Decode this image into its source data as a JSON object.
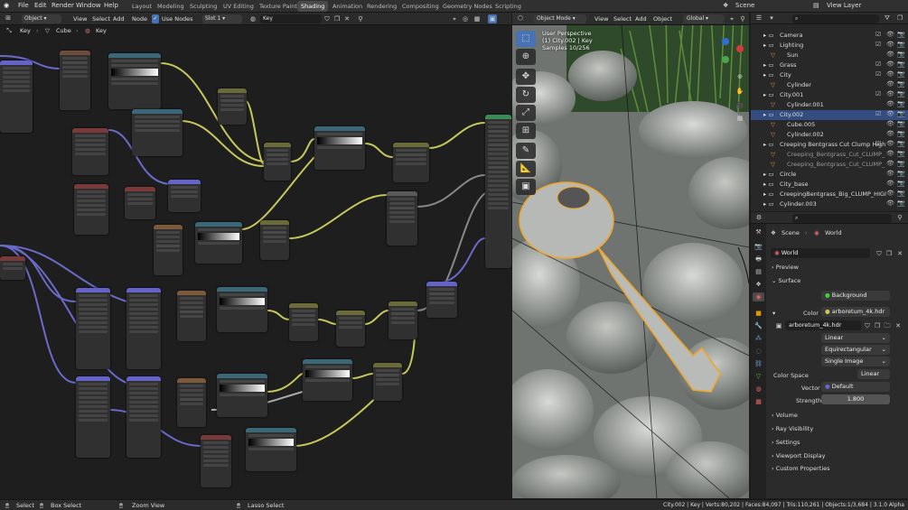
{
  "menu": {
    "file": "File",
    "edit": "Edit",
    "render": "Render",
    "window": "Window",
    "help": "Help"
  },
  "workspaces": [
    "Layout",
    "Modeling",
    "Sculpting",
    "UV Editing",
    "Texture Paint",
    "Shading",
    "Animation",
    "Rendering",
    "Compositing",
    "Geometry Nodes",
    "Scripting"
  ],
  "active_workspace": "Shading",
  "scene": {
    "label": "Scene"
  },
  "view_layer": {
    "label": "View Layer"
  },
  "node_editor": {
    "object_mode": "Object",
    "menus": [
      "View",
      "Select",
      "Add",
      "Node"
    ],
    "use_nodes_label": "Use Nodes",
    "slot": "Slot 1",
    "material": "Key",
    "breadcrumb": [
      "Key",
      "Cube",
      "Key"
    ]
  },
  "viewport": {
    "mode": "Object Mode",
    "menus": [
      "View",
      "Select",
      "Add",
      "Object"
    ],
    "orientation": "Global",
    "overlay_line1": "User Perspective",
    "overlay_line2": "(1) City.002 | Key",
    "overlay_line3": "Samples 10/256"
  },
  "outliner": {
    "rows": [
      {
        "name": "Camera",
        "indent": 1,
        "vis": "☑"
      },
      {
        "name": "Lighting",
        "indent": 1,
        "vis": "☑"
      },
      {
        "name": "Sun",
        "indent": 2,
        "vis": ""
      },
      {
        "name": "Grass",
        "indent": 1,
        "vis": "☑"
      },
      {
        "name": "City",
        "indent": 1,
        "vis": "☑"
      },
      {
        "name": "Cylinder",
        "indent": 2,
        "vis": ""
      },
      {
        "name": "City.001",
        "indent": 1,
        "vis": "☑"
      },
      {
        "name": "Cylinder.001",
        "indent": 2,
        "vis": ""
      },
      {
        "name": "City.002",
        "indent": 1,
        "vis": "☑"
      },
      {
        "name": "Cube.005",
        "indent": 2,
        "vis": ""
      },
      {
        "name": "Cylinder.002",
        "indent": 2,
        "vis": ""
      },
      {
        "name": "Creeping Bentgrass Cut Clump High",
        "indent": 1,
        "vis": "☑"
      },
      {
        "name": "Creeping_Bentgrass_Cut_CLUMP_",
        "indent": 2,
        "vis": ""
      },
      {
        "name": "Creeping_Bentgrass_Cut_CLUMP_",
        "indent": 2,
        "vis": ""
      },
      {
        "name": "Circle",
        "indent": 1,
        "vis": ""
      },
      {
        "name": "City_base",
        "indent": 1,
        "vis": ""
      },
      {
        "name": "CreepingBentgrass_Big_CLUMP_HIGI",
        "indent": 1,
        "vis": ""
      },
      {
        "name": "Cylinder.003",
        "indent": 1,
        "vis": ""
      }
    ]
  },
  "properties": {
    "breadcrumb_scene": "Scene",
    "breadcrumb_world": "World",
    "world_name": "World",
    "sections": {
      "preview": "Preview",
      "surface": "Surface",
      "volume": "Volume",
      "ray_visibility": "Ray Visibility",
      "settings": "Settings",
      "viewport_display": "Viewport Display",
      "custom_properties": "Custom Properties"
    },
    "surface_label": "Surface",
    "surface_value": "Background",
    "color_label": "Color",
    "color_value": "arboretum_4k.hdr",
    "image_name": "arboretum_4k.hdr",
    "interpolation": "Linear",
    "projection": "Equirectangular",
    "source": "Single Image",
    "color_space_label": "Color Space",
    "color_space_value": "Linear",
    "vector_label": "Vector",
    "vector_value": "Default",
    "strength_label": "Strength",
    "strength_value": "1.800"
  },
  "statusbar": {
    "select": "Select",
    "box_select": "Box Select",
    "zoom_view": "Zoom View",
    "lasso_select": "Lasso Select",
    "stats": "City.002 | Key | Verts:80,202 | Faces:84,097 | Tris:110,261 | Objects:1/3,684 | 3.1.0 Alpha"
  },
  "colors": {
    "accent": "#4772b3",
    "selected_outline": "#f5a623",
    "node_link_yellow": "#c7c75c",
    "node_link_purple": "#6a6ac9"
  }
}
